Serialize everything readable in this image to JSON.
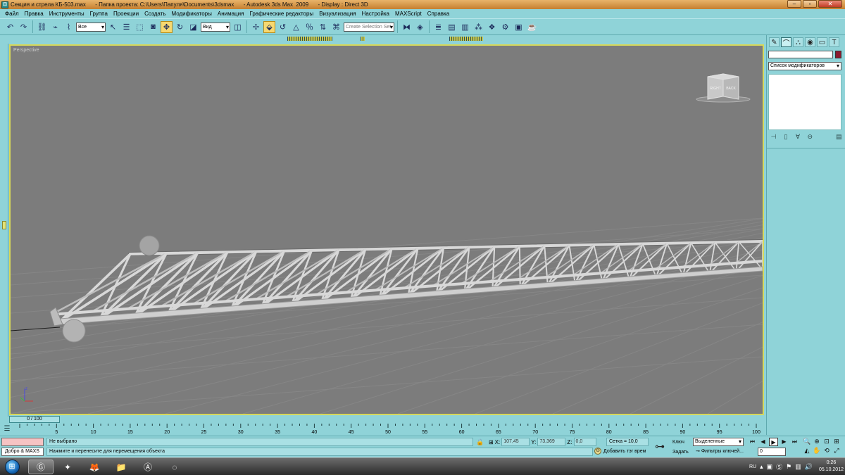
{
  "window": {
    "title": "Секция и стрела КБ-503.max      - Папка проекта: C:\\Users\\Папуля\\Documents\\3dsmax      - Autodesk 3ds Max  2009      - Display : Direct 3D",
    "controls": [
      "minimize-icon",
      "maximize-icon",
      "close-icon"
    ]
  },
  "menu": [
    "Файл",
    "Правка",
    "Инструменты",
    "Группа",
    "Проекции",
    "Создать",
    "Модификаторы",
    "Анимация",
    "Графические редакторы",
    "Визуализация",
    "Настройка",
    "MAXScript",
    "Справка"
  ],
  "toolbar": {
    "filter_value": "Все",
    "view_value": "Вид",
    "selection_set_placeholder": "Create Selection Set"
  },
  "viewport": {
    "label": "Perspective",
    "viewcube": {
      "left_face": "RIGHT",
      "right_face": "BACK"
    }
  },
  "command_panel": {
    "modifier_list": "Список модификаторов",
    "object_color": "#8b1a2e"
  },
  "time_slider": {
    "label": "0 / 100",
    "current": 0,
    "total": 100
  },
  "trackbar": {
    "ticks": [
      "5",
      "10",
      "15",
      "20",
      "25",
      "30",
      "35",
      "40",
      "45",
      "50",
      "55",
      "60",
      "65",
      "70",
      "75",
      "80",
      "85",
      "90",
      "95",
      "100"
    ]
  },
  "status": {
    "maxscript_label": "Добро & MAXS",
    "selection": "Не выбрано",
    "prompt": "Нажмите и перенесите для перемещения объекта",
    "x_label": "X:",
    "x_value": "107,45",
    "y_label": "Y:",
    "y_value": "73,369",
    "z_label": "Z:",
    "z_value": "0,0",
    "grid": "Сетка = 10,0",
    "add_time_tag": "Добавить тэг врем",
    "key_label": "Ключ",
    "set_label": "Задать",
    "selected_option": "Выделенные",
    "key_filters": "Фильтры ключей...",
    "frame": "0"
  },
  "taskbar": {
    "language": "RU",
    "time": "0:26",
    "date": "05.10.2012"
  }
}
